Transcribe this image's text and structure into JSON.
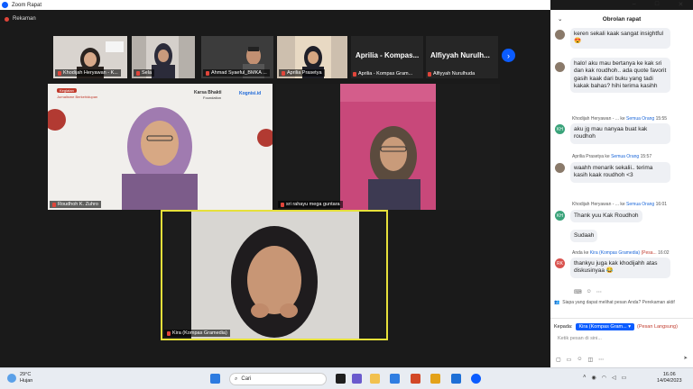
{
  "window": {
    "title": "Zoom Rapat",
    "recording": "Rekaman"
  },
  "gallery": {
    "thumbs": [
      "Khodijah Heryawan - K...",
      "Sela",
      "Ahmad Syaeful_BMKA ...",
      "Aprilia Prasetya"
    ],
    "name_cards": [
      {
        "big": "Aprilia - Kompas...",
        "label": "Aprilia - Kompas Gram..."
      },
      {
        "big": "Alfiyyah Nurulh...",
        "label": "Alfiyyah Nurulhuda"
      }
    ],
    "next": "›"
  },
  "main": {
    "speaker1": "Roudhoh K. Zuhro",
    "speaker2": "sri rahayu mega guntara",
    "speaker3": "Kira (Kompas Gramedia)",
    "slide": {
      "tag": "Kegiatan",
      "subtitle": "Jurnalisme Berkehidupan",
      "brand1": "Karsa Bhakti",
      "brand1_sub": "Foundation",
      "brand2": "Kognisi.id"
    }
  },
  "chat": {
    "title": "Obrolan rapat",
    "messages": [
      {
        "text": "keren sekali kaak sangat insightful 😍"
      },
      {
        "text": "halo! aku mau bertanya ke kak sri dan kak roudhoh.. ada quote favorit gasih kaak dari buku yang tadi kakak bahas? hihi terima kasihh"
      },
      {
        "sender": "Khodijah Heryawan - ...",
        "to_word": "ke",
        "to": "Semua Orang",
        "time": "15:55",
        "initials": "KH",
        "text": "aku jg mau nanyaa buat kak roudhoh"
      },
      {
        "sender": "Aprilia Prasetya",
        "to_word": "ke",
        "to": "Semua Orang",
        "time": "15:57",
        "text": "waahh menarik sekalii.. terima kasih kaak roudhoh <3"
      },
      {
        "sender": "Khodijah Heryawan - ...",
        "to_word": "ke",
        "to": "Semua Orang",
        "time": "16:01",
        "initials": "KH",
        "text": "Thank yuu Kak Roudhoh",
        "text2": "Sudaah"
      },
      {
        "sender": "Anda",
        "to_word": "ke",
        "to": "Kira (Kompas Gramedia)",
        "priv": "(Pesa...",
        "time": "16:02",
        "initials": "RK",
        "text": "thankyu juga kak khodijahh atas diskusinyaa 😂"
      }
    ],
    "privacy_note": "Siapa yang dapat melihat pesan Anda? Perekaman aktif",
    "to_label": "Kepada:",
    "to_value": "Kira (Kompas Gram...",
    "private_label": "(Pesan Langsung)",
    "placeholder": "Ketik pesan di sini..."
  },
  "taskbar": {
    "weather_temp": "29°C",
    "weather_desc": "Hujan",
    "search": "Cari",
    "time": "16.06",
    "date": "14/04/2023"
  },
  "colors": {
    "accent": "#0b5cff",
    "speaker_border": "#e6e03a",
    "kh_avatar": "#3aa37a",
    "rk_avatar": "#d9534f"
  }
}
